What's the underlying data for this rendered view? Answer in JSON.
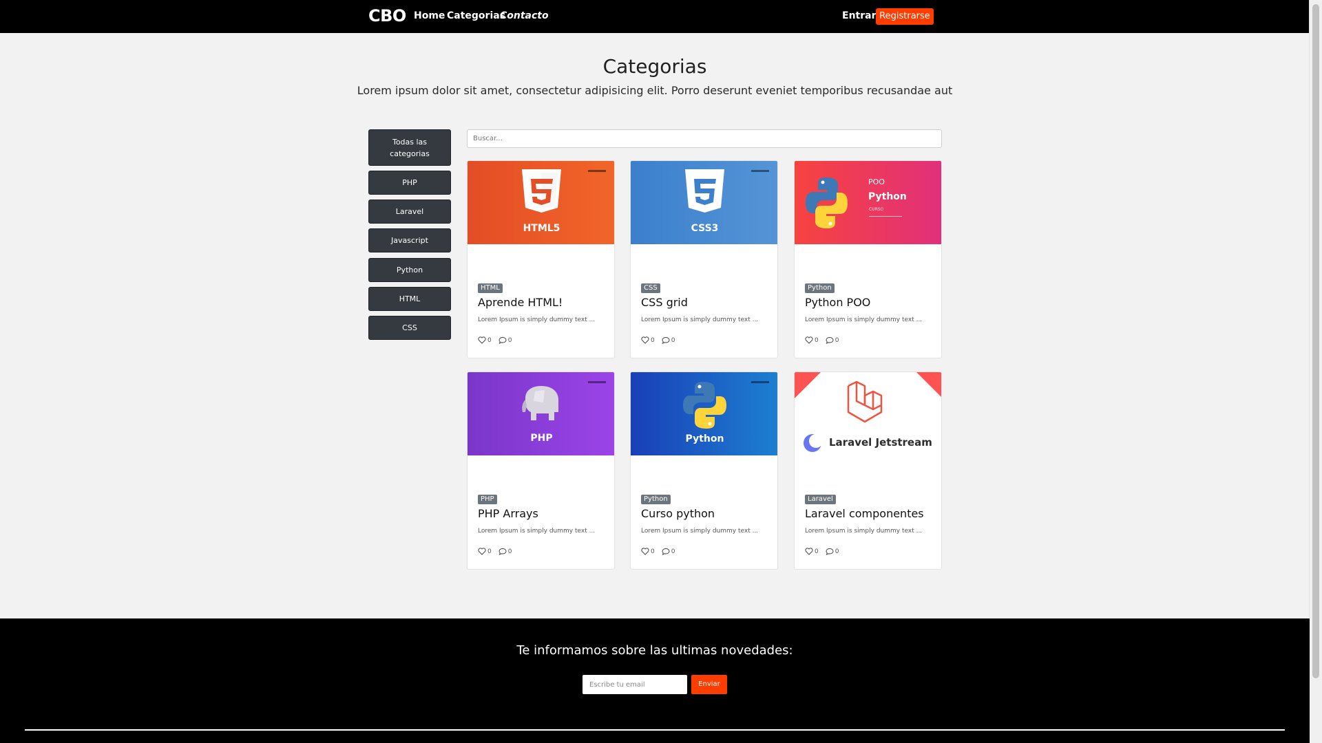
{
  "navbar": {
    "brand": "CBO",
    "links": [
      "Home",
      "Categorias",
      "Contacto"
    ],
    "login": "Entrar",
    "register": "Registrarse"
  },
  "header": {
    "title": "Categorias",
    "subtitle": "Lorem ipsum dolor sit amet, consectetur adipisicing elit. Porro deserunt eveniet temporibus recusandae aut"
  },
  "sidebar": {
    "items": [
      "Todas las categorias",
      "PHP",
      "Laravel",
      "Javascript",
      "Python",
      "HTML",
      "CSS"
    ]
  },
  "search": {
    "placeholder": "Buscar..."
  },
  "cards": [
    {
      "badge": "HTML",
      "title": "Aprende HTML!",
      "text": "Lorem Ipsum is simply dummy text ...",
      "likes": "0",
      "comments": "0",
      "image_label": "HTML5",
      "image_bg": "#e9541f"
    },
    {
      "badge": "CSS",
      "title": "CSS grid",
      "text": "Lorem Ipsum is simply dummy text ...",
      "likes": "0",
      "comments": "0",
      "image_label": "CSS3",
      "image_bg": "#4a86c8"
    },
    {
      "badge": "Python",
      "title": "Python POO",
      "text": "Lorem Ipsum is simply dummy text ...",
      "likes": "0",
      "comments": "0",
      "image_label": "Python",
      "image_label_small": "POO",
      "image_label_tiny": "CURSO",
      "image_bg": "#f0365a"
    },
    {
      "badge": "PHP",
      "title": "PHP Arrays",
      "text": "Lorem Ipsum is simply dummy text ...",
      "likes": "0",
      "comments": "0",
      "image_label": "PHP",
      "image_bg": "#7b3fd0"
    },
    {
      "badge": "Python",
      "title": "Curso python",
      "text": "Lorem Ipsum is simply dummy text ...",
      "likes": "0",
      "comments": "0",
      "image_label": "Python",
      "image_bg": "#1e57c6"
    },
    {
      "badge": "Laravel",
      "title": "Laravel componentes",
      "text": "Lorem Ipsum is simply dummy text ...",
      "likes": "0",
      "comments": "0",
      "image_label": "Laravel Jetstream",
      "image_bg": "#ffffff"
    }
  ],
  "footer": {
    "title": "Te informamos sobre las ultimas novedades:",
    "email_placeholder": "Escribe tu email",
    "send": "Enviar"
  },
  "colors": {
    "accent": "#ff3d00",
    "navbar": "#000000",
    "sidebar_button": "#343a40",
    "badge": "#6c757d"
  }
}
